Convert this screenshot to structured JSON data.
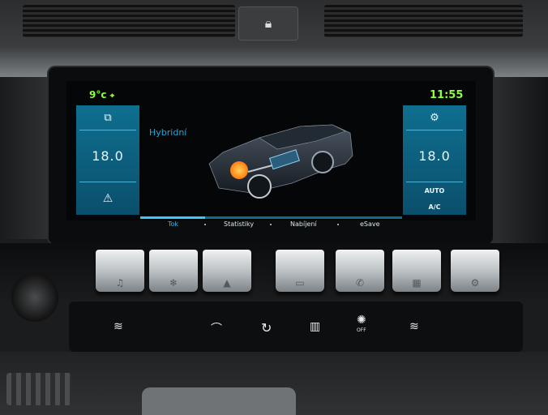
{
  "status": {
    "outside_temp": "9°c",
    "location_icon": "location-pin-icon",
    "clock": "11:55"
  },
  "left_panel": {
    "top_icon": "recirculation-icon",
    "temperature": "18.0",
    "bottom_icon": "seat-airflow-icon"
  },
  "right_panel": {
    "top_icon": "fan-settings-icon",
    "temperature": "18.0",
    "auto_label": "AUTO",
    "ac_label": "A/C"
  },
  "main": {
    "mode_label": "Hybridní"
  },
  "tabs": [
    {
      "label": "Tok",
      "active": true
    },
    {
      "label": "Statistiky",
      "active": false
    },
    {
      "label": "Nabíjení",
      "active": false
    },
    {
      "label": "eSave",
      "active": false
    }
  ],
  "piano_keys": [
    {
      "icon": "music-icon",
      "glyph": "♫"
    },
    {
      "icon": "ac-fan-icon",
      "glyph": "❄"
    },
    {
      "icon": "navigation-icon",
      "glyph": "▲"
    },
    {
      "icon": "car-icon",
      "glyph": "▭"
    },
    {
      "icon": "phone-icon",
      "glyph": "✆"
    },
    {
      "icon": "apps-icon",
      "glyph": "▦"
    },
    {
      "icon": "settings-icon",
      "glyph": "⚙"
    }
  ],
  "climate_buttons": [
    {
      "icon": "seat-heater-left-icon",
      "glyph": "≋"
    },
    {
      "icon": "front-defrost-icon",
      "glyph": "⌒"
    },
    {
      "icon": "recirculate-icon",
      "glyph": "↻"
    },
    {
      "icon": "rear-defrost-icon",
      "glyph": "▥"
    },
    {
      "icon": "fan-off-icon",
      "glyph": "✺",
      "label": "OFF"
    },
    {
      "icon": "seat-heater-right-icon",
      "glyph": "≋"
    }
  ],
  "colors": {
    "accent_green": "#8cff38",
    "accent_blue": "#38b9ee",
    "panel_blue": "#0f6f8f",
    "engine_orange": "#ff8a1c"
  }
}
